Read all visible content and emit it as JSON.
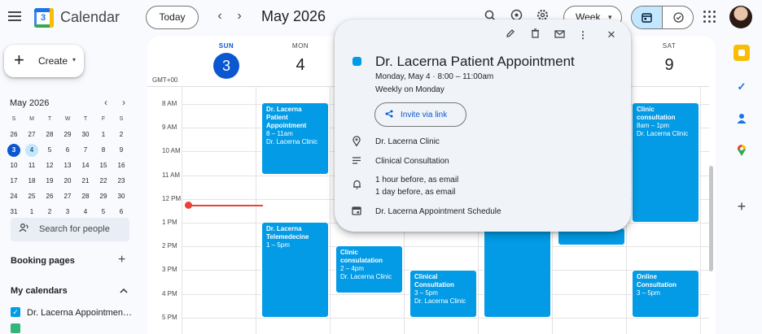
{
  "app": {
    "title": "Calendar",
    "logo_number": "3"
  },
  "toolbar": {
    "today": "Today",
    "prev": "‹",
    "next": "›",
    "month": "May 2026",
    "view": "Week",
    "view_caret": "▾"
  },
  "create": {
    "label": "Create",
    "plus": "+",
    "caret": "▾"
  },
  "mini_calendar": {
    "title": "May 2026",
    "weekdays": [
      "S",
      "M",
      "T",
      "W",
      "T",
      "F",
      "S"
    ],
    "weeks": [
      [
        "26",
        "27",
        "28",
        "29",
        "30",
        "1",
        "2"
      ],
      [
        "3",
        "4",
        "5",
        "6",
        "7",
        "8",
        "9"
      ],
      [
        "10",
        "11",
        "12",
        "13",
        "14",
        "15",
        "16"
      ],
      [
        "17",
        "18",
        "19",
        "20",
        "21",
        "22",
        "23"
      ],
      [
        "24",
        "25",
        "26",
        "27",
        "28",
        "29",
        "30"
      ],
      [
        "31",
        "1",
        "2",
        "3",
        "4",
        "5",
        "6"
      ]
    ],
    "today": "3",
    "selected": "4"
  },
  "sidebar": {
    "search_people": "Search for people",
    "booking_pages": "Booking pages",
    "my_calendars": "My calendars",
    "calendar_item": "Dr. Lacerna Appointment ..."
  },
  "week": {
    "timezone": "GMT+00",
    "days": [
      {
        "name": "SUN",
        "date": "3"
      },
      {
        "name": "MON",
        "date": "4"
      },
      {
        "name": "SAT",
        "date": "9"
      }
    ],
    "hours": [
      "8 AM",
      "9 AM",
      "10 AM",
      "11 AM",
      "12 PM",
      "1 PM",
      "2 PM",
      "3 PM",
      "4 PM",
      "5 PM"
    ]
  },
  "events": {
    "mon_patient": {
      "title": "Dr. Lacerna Patient Appointment",
      "time": "8 – 11am",
      "location": "Dr. Lacerna Clinic"
    },
    "mon_tele": {
      "title": "Dr. Lacerna Telemedecine",
      "time": "1 – 5pm"
    },
    "tue_clinic": {
      "title": "Clinic consulatation",
      "time": "2 – 4pm",
      "location": "Dr. Lacerna Clinic"
    },
    "wed_clinical": {
      "title": "Clinical Consultation",
      "time": "3 – 5pm",
      "location": "Dr. Lacerna Clinic"
    },
    "sat_clinic": {
      "title": "Clinic consultation",
      "time": "8am – 1pm",
      "location": "Dr. Lacerna Clinic"
    },
    "sat_online": {
      "title": "Online Consultation",
      "time": "3 – 5pm"
    }
  },
  "popup": {
    "title": "Dr. Lacerna Patient Appointment",
    "when": "Monday, May 4  ·  8:00 – 11:00am",
    "repeat": "Weekly on Monday",
    "invite": "Invite via link",
    "location": "Dr. Lacerna Clinic",
    "description": "Clinical Consultation",
    "reminder_1": "1 hour before, as email",
    "reminder_2": "1 day before, as email",
    "calendar": "Dr. Lacerna Appointment Schedule"
  },
  "colors": {
    "event": "#039be5",
    "accent": "#0b57d0",
    "now": "#ea4335"
  }
}
